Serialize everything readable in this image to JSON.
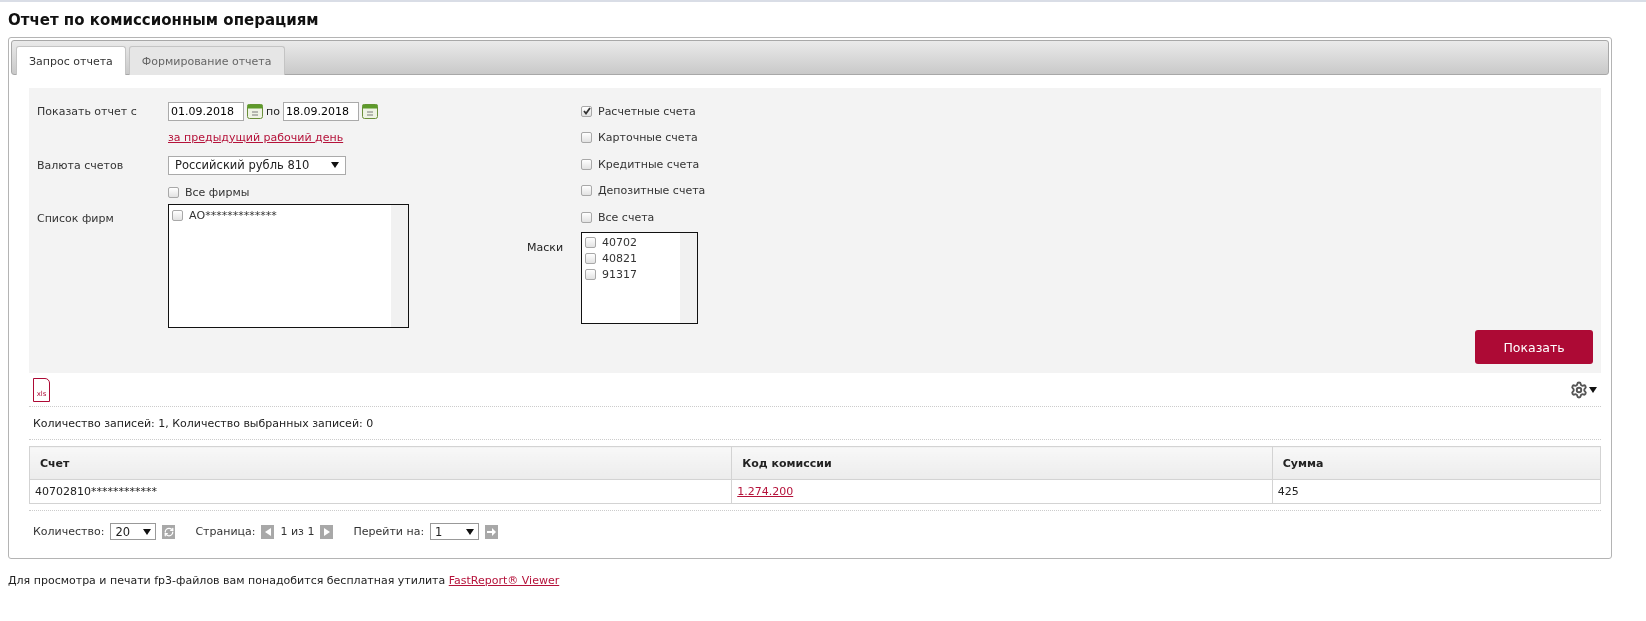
{
  "page": {
    "title": "Отчет по комиссионным операциям"
  },
  "tabs": [
    {
      "label": "Запрос отчета",
      "selected": true
    },
    {
      "label": "Формирование отчета",
      "selected": false
    }
  ],
  "form": {
    "period": {
      "label": "Показать отчет с",
      "from": "01.09.2018",
      "separator": "по",
      "to": "18.09.2018",
      "shortcut_link": "за предыдущий рабочий день"
    },
    "currency": {
      "label": "Валюта счетов",
      "value": "Российский рубль 810"
    },
    "all_firms": {
      "label": "Все фирмы",
      "checked": false
    },
    "firms": {
      "label": "Список фирм",
      "items": [
        {
          "label": "АО*************",
          "checked": false
        }
      ]
    },
    "account_types": [
      {
        "label": "Расчетные счета",
        "checked": true
      },
      {
        "label": "Карточные счета",
        "checked": false
      },
      {
        "label": "Кредитные счета",
        "checked": false
      },
      {
        "label": "Депозитные счета",
        "checked": false
      },
      {
        "label": "Все счета",
        "checked": false
      }
    ],
    "masks": {
      "label": "Маски",
      "items": [
        {
          "label": "40702",
          "checked": false
        },
        {
          "label": "40821",
          "checked": false
        },
        {
          "label": "91317",
          "checked": false
        }
      ]
    },
    "submit": "Показать"
  },
  "export": {
    "label": "xls"
  },
  "records_summary": "Количество записей: 1, Количество выбранных записей: 0",
  "table": {
    "columns": [
      "Счет",
      "Код комиссии",
      "Сумма"
    ],
    "rows": [
      [
        {
          "kind": "text",
          "text": "40702810************"
        },
        {
          "kind": "link",
          "text": "1.274.200"
        },
        {
          "kind": "text",
          "text": "425"
        }
      ]
    ]
  },
  "pagination": {
    "count_label": "Количество:",
    "count_value": "20",
    "page_label": "Страница:",
    "page_text": "1 из 1",
    "goto_label": "Перейти на:",
    "goto_value": "1"
  },
  "footer": {
    "text": "Для просмотра и печати fp3-файлов вам понадобится бесплатная утилита",
    "link": "FastReport® Viewer"
  }
}
